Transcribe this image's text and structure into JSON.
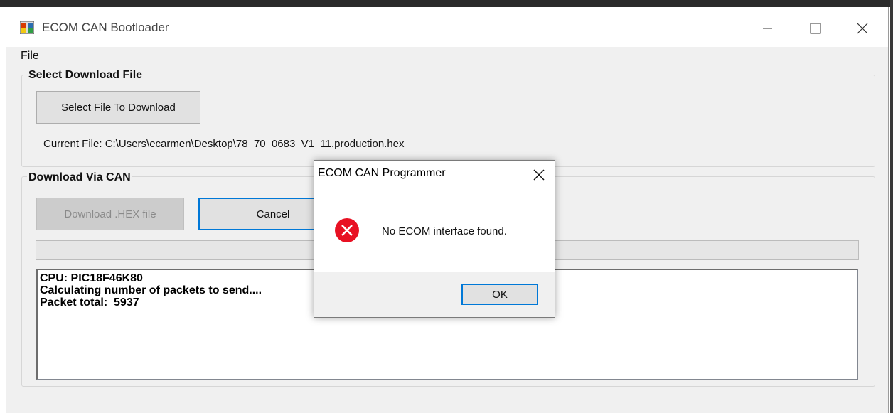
{
  "window": {
    "title": "ECOM CAN Bootloader",
    "menu": [
      "File"
    ]
  },
  "select_group": {
    "legend": "Select Download File",
    "select_button": "Select File To Download",
    "current_file": "Current File: C:\\Users\\ecarmen\\Desktop\\78_70_0683_V1_11.production.hex"
  },
  "download_group": {
    "legend": "Download Via CAN",
    "download_button": "Download .HEX file",
    "cancel_button": "Cancel",
    "progress": 0
  },
  "log": {
    "lines": [
      "CPU: PIC18F46K80",
      "Calculating number of packets to send....",
      "Packet total:  5937"
    ]
  },
  "dialog": {
    "title": "ECOM CAN Programmer",
    "message": "No ECOM interface found.",
    "ok_button": "OK",
    "icon": "error-icon"
  },
  "colors": {
    "accent": "#0078d7",
    "error": "#e81123"
  }
}
